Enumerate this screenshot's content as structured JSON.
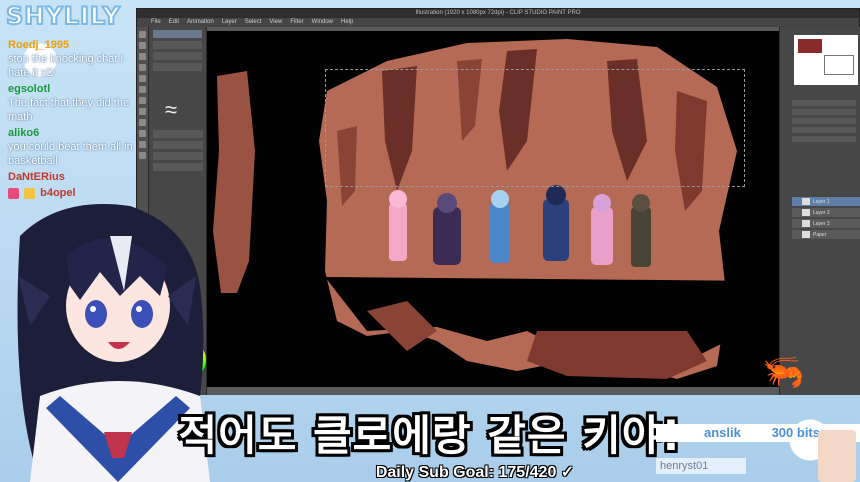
{
  "stream": {
    "logo": "SHYLILY",
    "subtitle": "적어도 클로에랑 같은 키야!",
    "goal": "Daily Sub Goal: 175/420 ✓"
  },
  "chat": [
    {
      "user": "Roedj_1995",
      "text": "stop the knocking chat i hate it xD",
      "color": "#f0a000"
    },
    {
      "user": "egsolotl",
      "text": "The fact that they did the math",
      "color": "#1a9a3a"
    },
    {
      "user": "aliko6",
      "text": "you could beat them all in basketball",
      "color": "#1a9a3a"
    },
    {
      "user": "DaNtERius",
      "text": "",
      "color": "#c0392b"
    },
    {
      "user": "b4opel",
      "text": "",
      "color": "#c0392b"
    }
  ],
  "leaderboard": {
    "top_user": "anslik",
    "top_amount": "300 bits",
    "second_user": "henryst01"
  },
  "app": {
    "title": "Illustration (1920 x 1080px 72dpi) - CLIP STUDIO PAINT PRO",
    "menu": [
      "File",
      "Edit",
      "Animation",
      "Layer",
      "Select",
      "View",
      "Filter",
      "Window",
      "Help"
    ],
    "layers": [
      "Layer 1",
      "Layer 2",
      "Layer 3",
      "Paper"
    ]
  },
  "colors": {
    "cave_light": "#b46a55",
    "cave_dark": "#6a2f28",
    "cave_mid": "#8a4436",
    "accent": "#4a90d9"
  },
  "icons": [
    "brush-icon",
    "color-wheel-icon",
    "shrimp-icon"
  ]
}
